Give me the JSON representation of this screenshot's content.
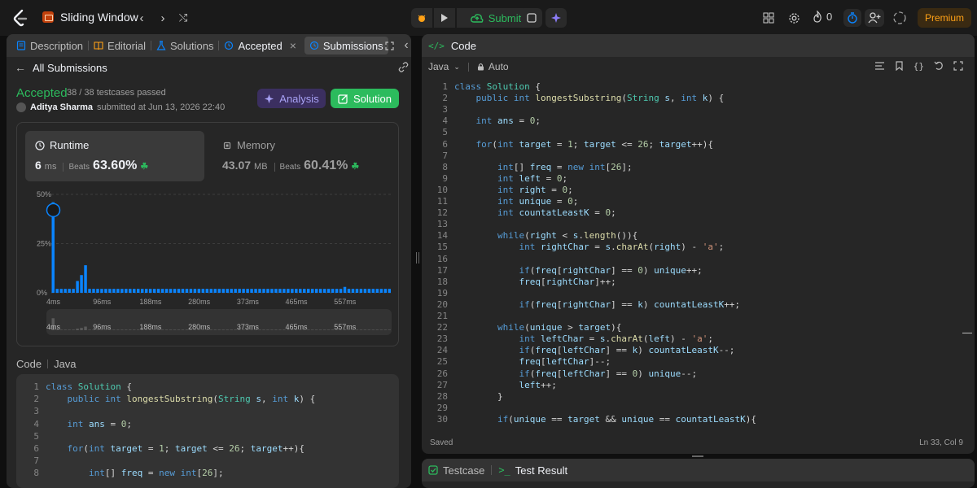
{
  "topbar": {
    "problem_title": "Sliding Window",
    "submit_label": "Submit",
    "streak": "0",
    "premium_label": "Premium"
  },
  "left": {
    "tabs": [
      "Description",
      "Editorial",
      "Solutions",
      "Accepted",
      "Submissions"
    ],
    "all_submissions": "All Submissions",
    "status": "Accepted",
    "testcases": "38 / 38 testcases passed",
    "user": "Aditya Sharma",
    "submitted": "submitted at Jun 13, 2026 22:40",
    "analysis_label": "Analysis",
    "solution_label": "Solution",
    "runtime": {
      "label": "Runtime",
      "value": "6",
      "unit": "ms",
      "beats": "Beats",
      "pct": "63.60%"
    },
    "memory": {
      "label": "Memory",
      "value": "43.07",
      "unit": "MB",
      "beats": "Beats",
      "pct": "60.41%"
    },
    "code_label": "Code",
    "code_lang": "Java"
  },
  "chart_data": {
    "type": "bar",
    "ytick_labels": [
      "50%",
      "25%",
      "0%"
    ],
    "xtick_labels": [
      "4ms",
      "96ms",
      "188ms",
      "280ms",
      "373ms",
      "465ms",
      "557ms"
    ],
    "ylim": [
      0,
      50
    ],
    "values": [
      46,
      2,
      2,
      2,
      2,
      2,
      6,
      9,
      14,
      2,
      2,
      2,
      2,
      2,
      2,
      2,
      2,
      2,
      2,
      2,
      2,
      2,
      2,
      2,
      2,
      2,
      2,
      2,
      2,
      2,
      2,
      2,
      2,
      2,
      2,
      2,
      2,
      2,
      2,
      2,
      2,
      2,
      2,
      2,
      2,
      2,
      2,
      2,
      2,
      2,
      2,
      2,
      2,
      2,
      2,
      2,
      2,
      2,
      2,
      2,
      2,
      2,
      2,
      2,
      2,
      2,
      2,
      2,
      2,
      2,
      2,
      2,
      3,
      2,
      2,
      2,
      2,
      2,
      2,
      2,
      2,
      2,
      2,
      2
    ],
    "highlight_index": 0,
    "bar_color": "#0a84ff"
  },
  "right": {
    "title": "Code",
    "lang": "Java",
    "mode": "Auto",
    "saved": "Saved",
    "cursor": "Ln 33, Col 9"
  },
  "bottom": {
    "testcase": "Testcase",
    "test_result": "Test Result"
  },
  "code_lines": [
    "class Solution {",
    "    public int longestSubstring(String s, int k) {",
    "",
    "    int ans = 0;",
    "",
    "    for(int target = 1; target <= 26; target++){",
    "",
    "        int[] freq = new int[26];",
    "        int left = 0;",
    "        int right = 0;",
    "        int unique = 0;",
    "        int countatLeastK = 0;",
    "",
    "        while(right < s.length()){",
    "            int rightChar = s.charAt(right) - 'a';",
    "",
    "            if(freq[rightChar] == 0) unique++;",
    "            freq[rightChar]++;",
    "",
    "            if(freq[rightChar] == k) countatLeastK++;",
    "",
    "        while(unique > target){",
    "            int leftChar = s.charAt(left) - 'a';",
    "            if(freq[leftChar] == k) countatLeastK--;",
    "            freq[leftChar]--;",
    "            if(freq[leftChar] == 0) unique--;",
    "            left++;",
    "        }",
    "",
    "        if(unique == target && unique == countatLeastK){"
  ]
}
